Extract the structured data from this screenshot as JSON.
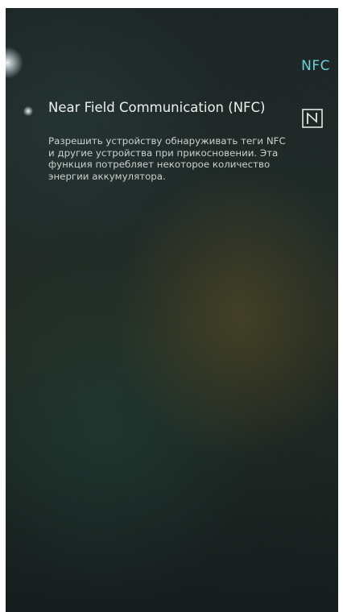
{
  "header": {
    "title": "NFC"
  },
  "nfc_setting": {
    "title": "Near Field Communication (NFC)",
    "description": "Разрешить устройству обнаруживать теги NFC и другие устройства при прикосновении. Эта функция потребляет некоторое количество энергии аккумулятора.",
    "icon": "nfc-icon"
  },
  "colors": {
    "accent": "#6fd3d8",
    "title_text": "#f1f3f2",
    "body_text": "#cfd3d1"
  }
}
